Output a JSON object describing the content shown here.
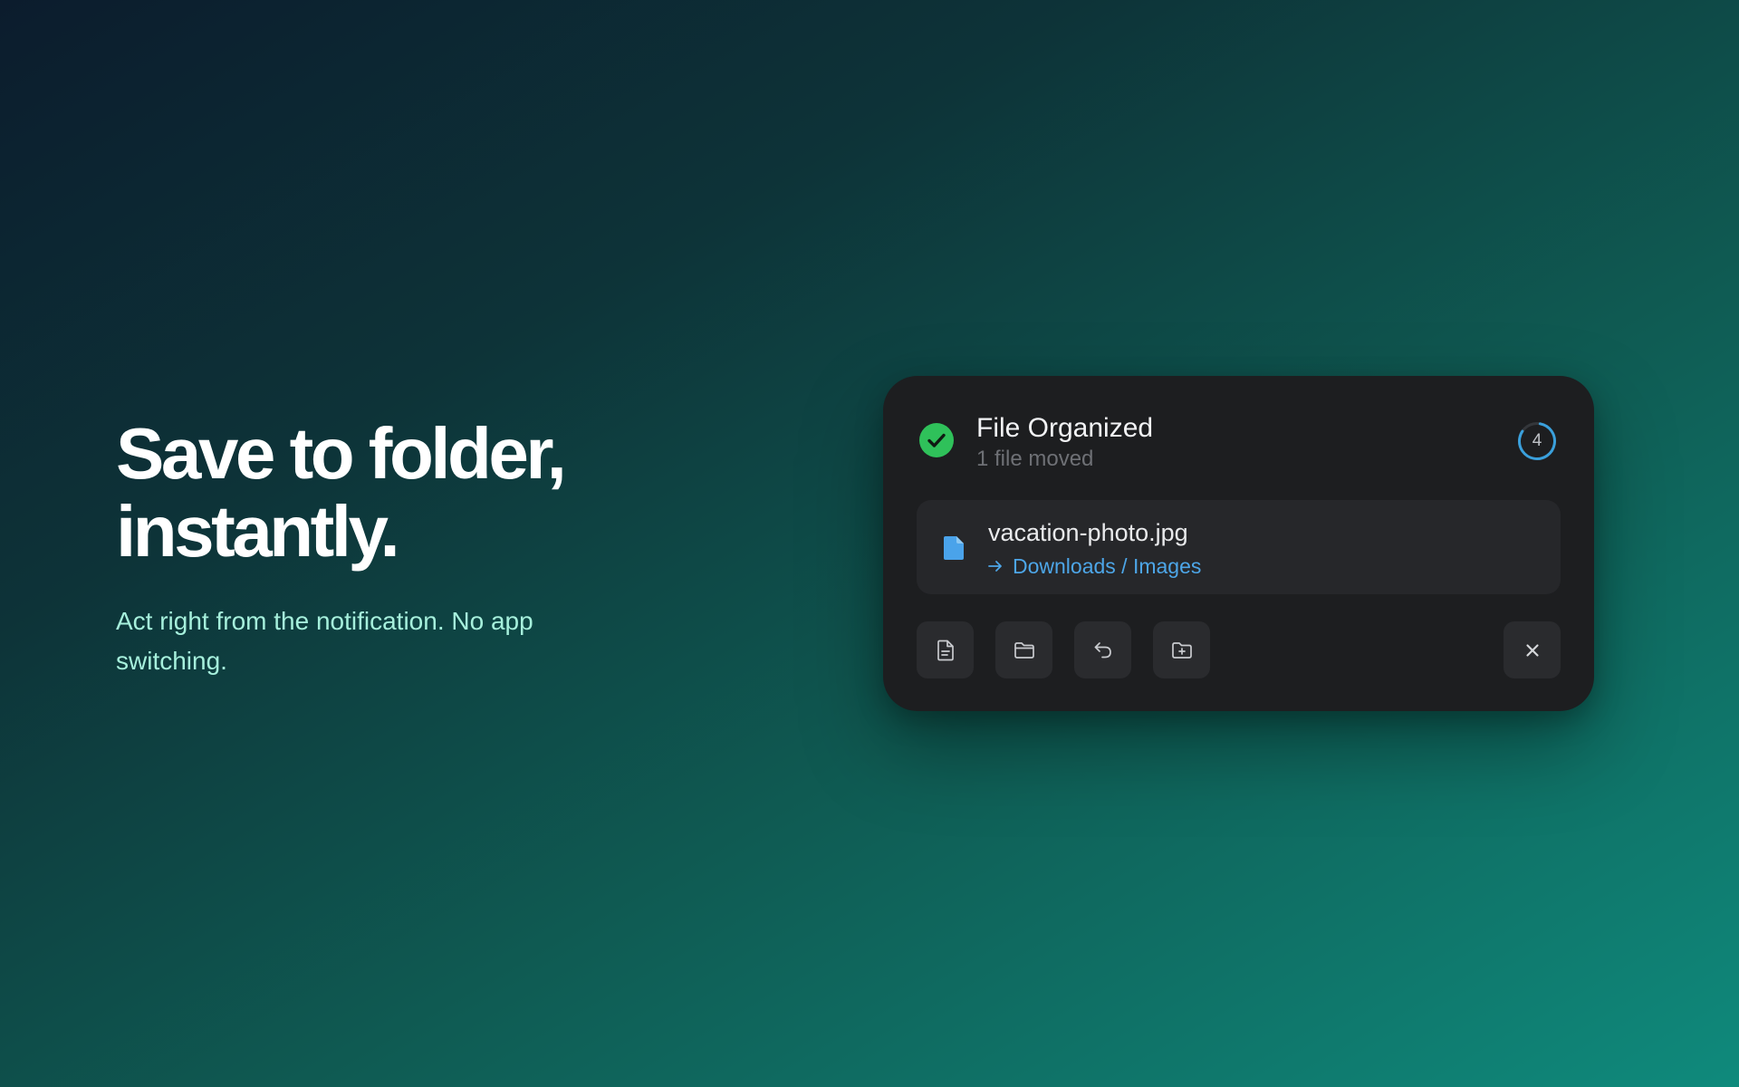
{
  "hero": {
    "title_line1": "Save to folder,",
    "title_line2": "instantly.",
    "subtitle": "Act right from the notification. No app switching."
  },
  "notification": {
    "status_icon": "check-circle-icon",
    "title": "File Organized",
    "subtitle": "1 file moved",
    "countdown": "4",
    "file": {
      "icon": "file-icon",
      "name": "vacation-photo.jpg",
      "arrow_icon": "arrow-right-icon",
      "destination": "Downloads / Images"
    },
    "actions": [
      {
        "name": "open-file",
        "icon": "document-icon"
      },
      {
        "name": "show-in-folder",
        "icon": "folder-icon"
      },
      {
        "name": "undo",
        "icon": "undo-icon"
      },
      {
        "name": "move-to-folder",
        "icon": "folder-plus-icon"
      }
    ],
    "dismiss_icon": "close-icon"
  },
  "colors": {
    "success": "#2fc15a",
    "link": "#4da6e8",
    "card_bg": "#1d1e20",
    "hero_subtitle": "#a6f0dc"
  }
}
